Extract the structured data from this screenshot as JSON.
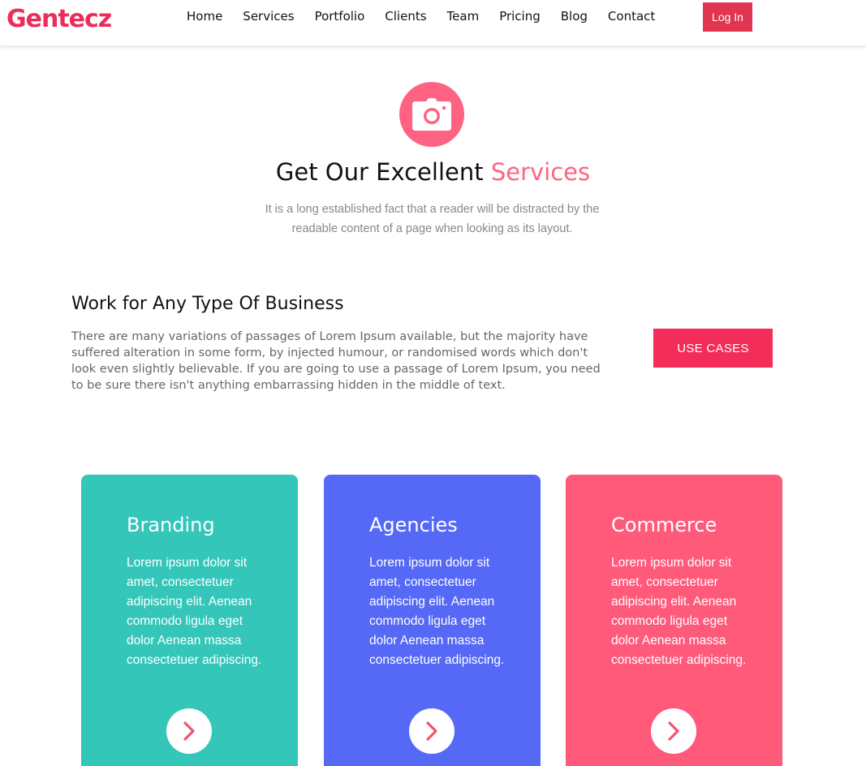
{
  "header": {
    "logo": "Gentecz",
    "nav": [
      "Home",
      "Services",
      "Portfolio",
      "Clients",
      "Team",
      "Pricing",
      "Blog",
      "Contact"
    ],
    "login_label": "Log In"
  },
  "intro": {
    "icon": "camera-icon",
    "title_main": "Get Our Excellent ",
    "title_accent": "Services",
    "description": "It is a long established fact that a reader will be distracted by the readable content of a page when looking as its layout."
  },
  "business": {
    "title": "Work for Any Type Of Business",
    "text": "There are many variations of passages of Lorem Ipsum available, but the majority have suffered alteration in some form, by injected humour, or randomised words which don't look even slightly believable. If you are going to use a passage of Lorem Ipsum, you need to be sure there isn't anything embarrassing hidden in the middle of text.",
    "button_label": "USE CASES"
  },
  "cards": [
    {
      "title": "Branding",
      "text": "Lorem ipsum dolor sit amet, consectetuer adipiscing elit. Aenean commodo ligula eget dolor Aenean massa consectetuer adipiscing.",
      "color": "#33C6B9",
      "icon": "chevron-right-icon"
    },
    {
      "title": "Agencies",
      "text": "Lorem ipsum dolor sit amet, consectetuer adipiscing elit. Aenean commodo ligula eget dolor Aenean massa consectetuer adipiscing.",
      "color": "#5569F6",
      "icon": "chevron-right-icon"
    },
    {
      "title": "Commerce",
      "text": "Lorem ipsum dolor sit amet, consectetuer adipiscing elit. Aenean commodo ligula eget dolor Aenean massa consectetuer adipiscing.",
      "color": "#FF5A7A",
      "icon": "chevron-right-icon"
    }
  ],
  "colors": {
    "brand": "#EC2C59",
    "accent": "#FF6381",
    "login_button": "#E0344F",
    "cta_button": "#F32C59",
    "chevron": "#F25572"
  }
}
